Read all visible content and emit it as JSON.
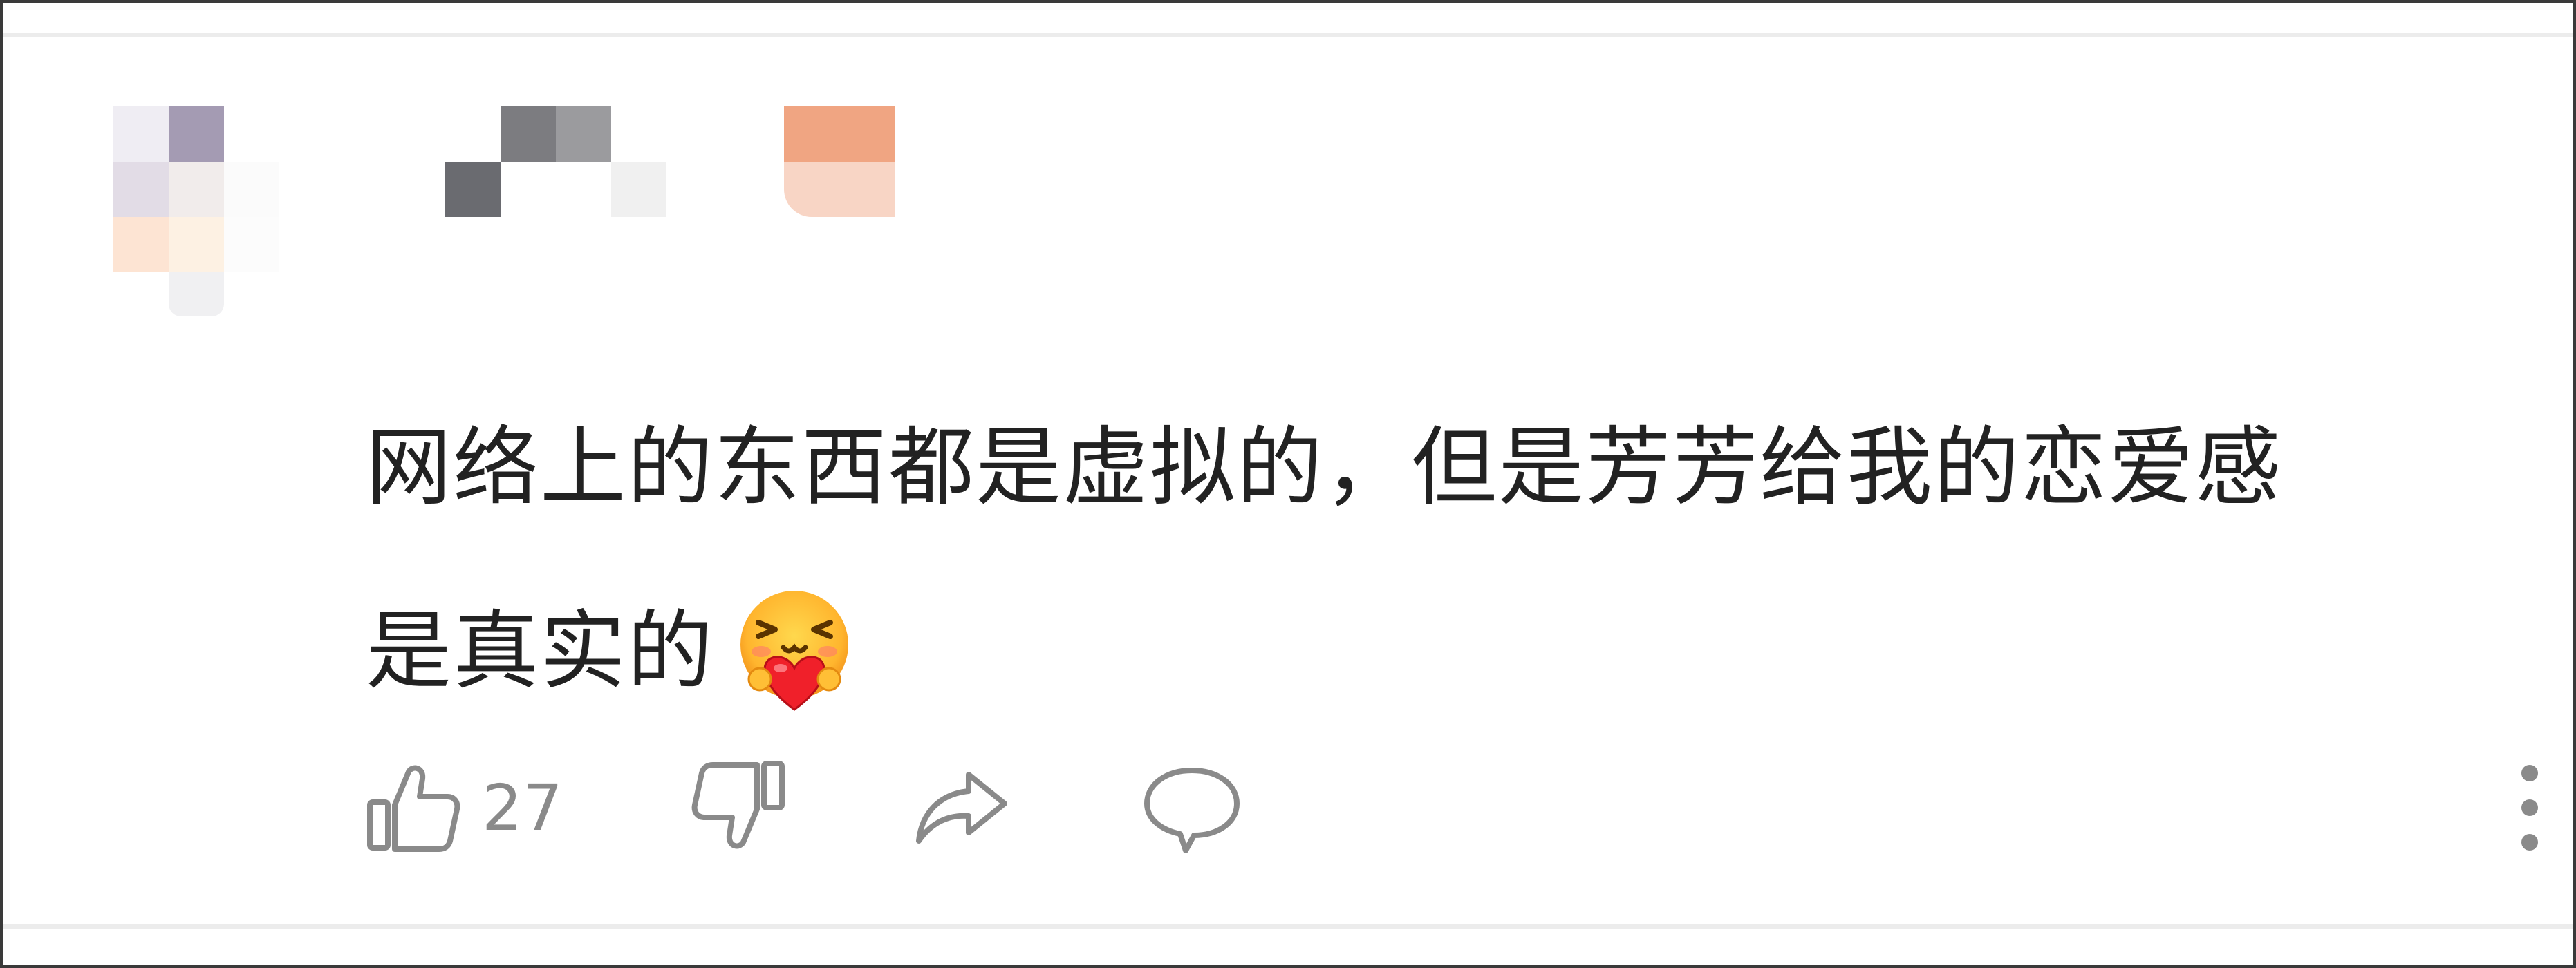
{
  "comment": {
    "lines": [
      "网络上的东西都是虚拟的，但是芳芳给我的恋爱感",
      "是真实的"
    ],
    "emoji_icon": "hug-heart-emoji"
  },
  "actions": {
    "like_icon": "thumbs-up-icon",
    "like_count": "27",
    "dislike_icon": "thumbs-down-icon",
    "share_icon": "share-arrow-icon",
    "reply_icon": "comment-bubble-icon",
    "more_icon": "more-vertical-icon"
  },
  "colors": {
    "text": "#222222",
    "icon": "#8a8a8a",
    "separator": "#ececec"
  }
}
